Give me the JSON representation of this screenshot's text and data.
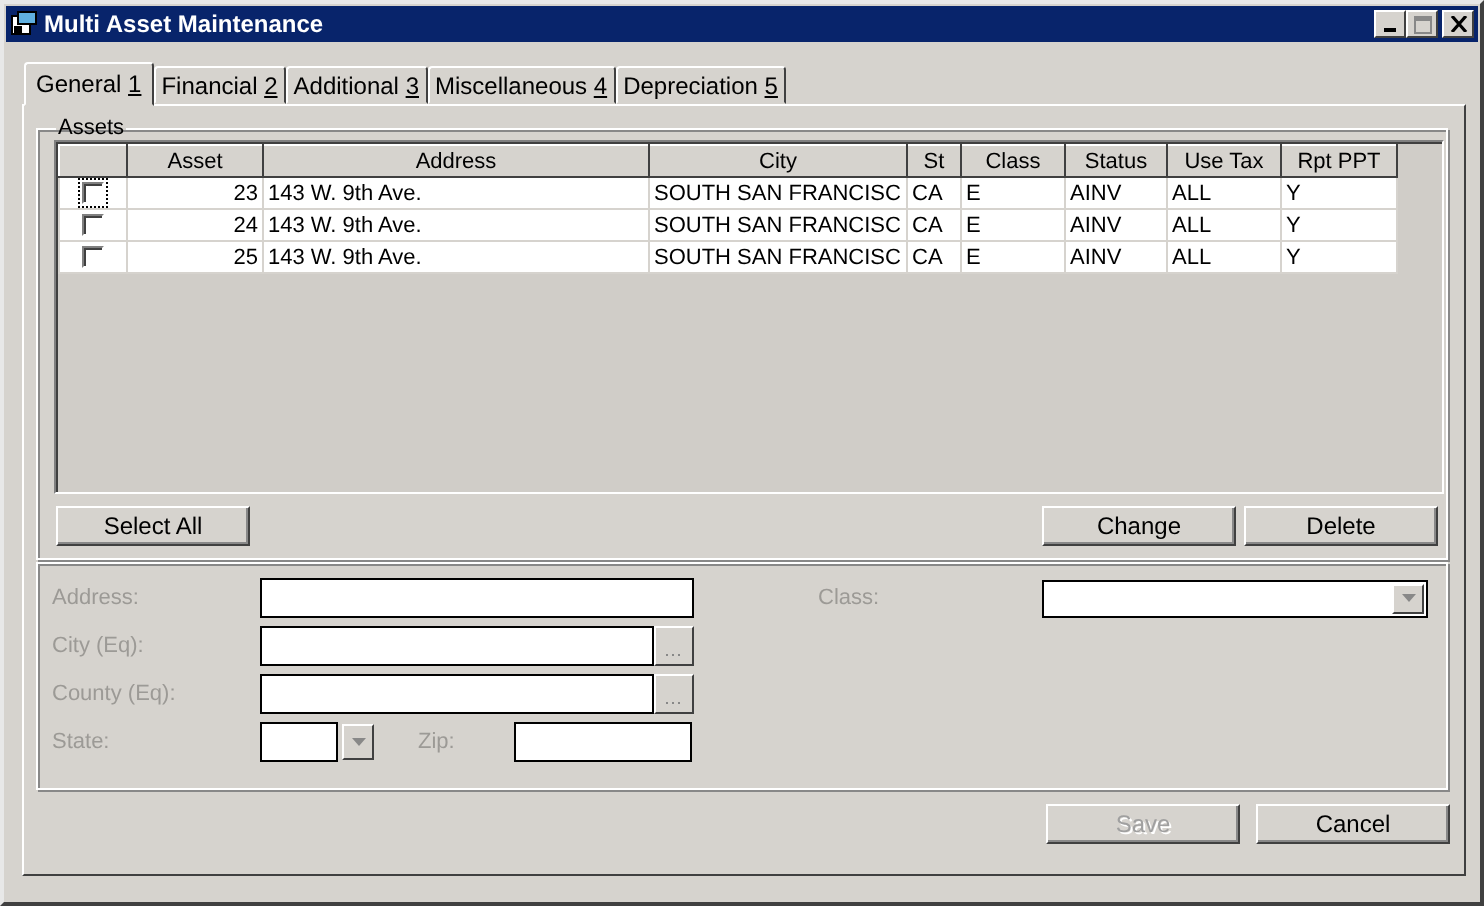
{
  "window": {
    "title": "Multi Asset Maintenance"
  },
  "tabs": [
    {
      "label": "General",
      "hotkey": "1",
      "selected": true
    },
    {
      "label": "Financial",
      "hotkey": "2",
      "selected": false
    },
    {
      "label": "Additional",
      "hotkey": "3",
      "selected": false
    },
    {
      "label": "Miscellaneous",
      "hotkey": "4",
      "selected": false
    },
    {
      "label": "Depreciation",
      "hotkey": "5",
      "selected": false
    }
  ],
  "assets": {
    "title": "Assets",
    "columns": [
      "Asset",
      "Address",
      "City",
      "St",
      "Class",
      "Status",
      "Use Tax",
      "Rpt PPT"
    ],
    "rows": [
      {
        "checked": false,
        "focused": true,
        "cells": [
          "23",
          "143 W. 9th Ave.",
          "SOUTH SAN FRANCISC",
          "CA",
          "E",
          "AINV",
          "ALL",
          "Y"
        ]
      },
      {
        "checked": false,
        "focused": false,
        "cells": [
          "24",
          "143 W. 9th Ave.",
          "SOUTH SAN FRANCISC",
          "CA",
          "E",
          "AINV",
          "ALL",
          "Y"
        ]
      },
      {
        "checked": false,
        "focused": false,
        "cells": [
          "25",
          "143 W. 9th Ave.",
          "SOUTH SAN FRANCISC",
          "CA",
          "E",
          "AINV",
          "ALL",
          "Y"
        ]
      }
    ],
    "left_buttons": [
      {
        "label": "Select All",
        "disabled": false
      }
    ],
    "right_buttons": [
      {
        "label": "Change",
        "disabled": false
      },
      {
        "label": "Delete",
        "disabled": false
      }
    ]
  },
  "details": {
    "left_fields": [
      {
        "label": "Address:",
        "kind": "text",
        "disabled": true
      },
      {
        "label": "City (Eq):",
        "kind": "lookup",
        "disabled": true
      },
      {
        "label": "County (Eq):",
        "kind": "lookup",
        "disabled": true
      }
    ],
    "state_field": {
      "label": "State:",
      "kind": "dropdown",
      "disabled": true
    },
    "zip_field": {
      "label": "Zip:",
      "kind": "text",
      "disabled": true
    },
    "right_fields": [
      {
        "label": "Class:",
        "kind": "dropdown",
        "disabled": true
      }
    ]
  },
  "footer_buttons": [
    {
      "label": "Save",
      "disabled": true
    },
    {
      "label": "Cancel",
      "disabled": false
    }
  ]
}
